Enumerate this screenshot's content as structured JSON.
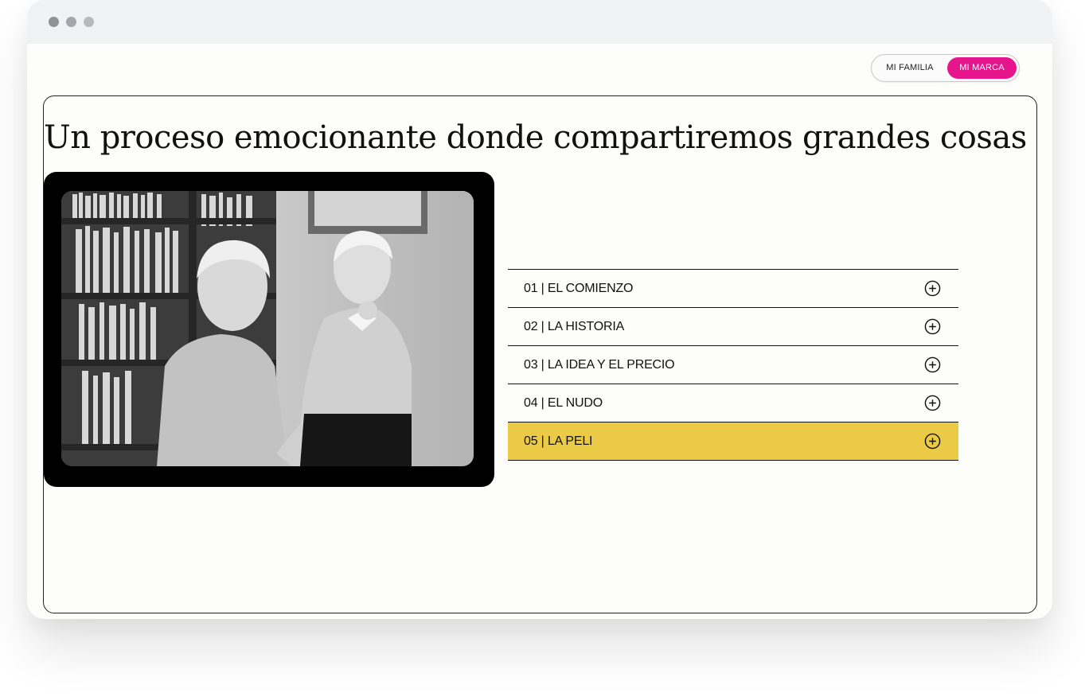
{
  "window": {
    "controls": [
      "close-dot",
      "minimize-dot",
      "maximize-dot"
    ]
  },
  "toggle": {
    "options": [
      {
        "label": "MI FAMILIA",
        "active": false
      },
      {
        "label": "MI MARCA",
        "active": true
      }
    ],
    "active_color": "#e6158c"
  },
  "main": {
    "headline": "Un proceso emocionante donde compartiremos grandes cosas",
    "video": {
      "icon": "video-frame"
    },
    "accordion": {
      "items": [
        {
          "label": "01 | EL COMIENZO",
          "icon": "plus-circle-icon",
          "active": false
        },
        {
          "label": "02 | LA HISTORIA",
          "icon": "plus-circle-icon",
          "active": false
        },
        {
          "label": "03 | LA IDEA Y EL PRECIO",
          "icon": "plus-circle-icon",
          "active": false
        },
        {
          "label": "04 | EL NUDO",
          "icon": "plus-circle-icon",
          "active": false
        },
        {
          "label": "05 | LA PELI",
          "icon": "plus-circle-icon",
          "active": true
        }
      ],
      "active_color": "#ebcb45"
    }
  }
}
